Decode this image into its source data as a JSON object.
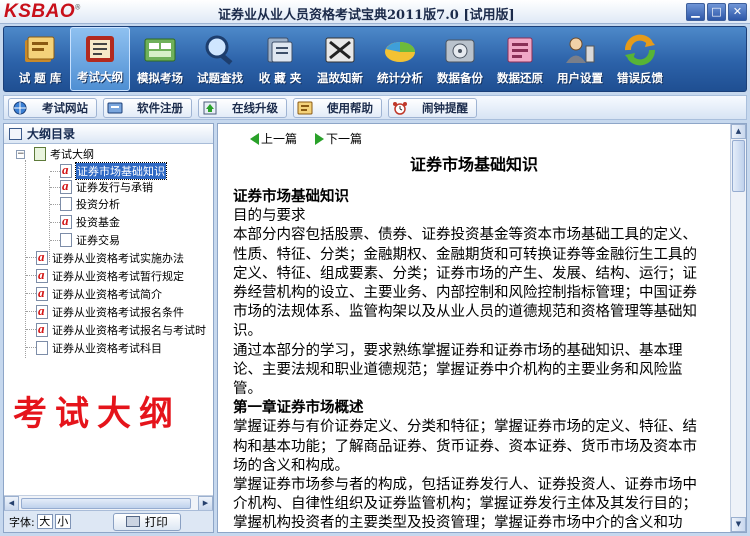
{
  "app": {
    "logo": "KSBAO",
    "logo_mark": "®",
    "title": "证券业从业人员资格考试宝典2011版7.0 [试用版]"
  },
  "toolbar": {
    "items": [
      {
        "label": "试 题 库",
        "icon": "question-bank-icon"
      },
      {
        "label": "考试大纲",
        "icon": "syllabus-icon"
      },
      {
        "label": "模拟考场",
        "icon": "mock-exam-icon"
      },
      {
        "label": "试题查找",
        "icon": "search-icon"
      },
      {
        "label": "收 藏 夹",
        "icon": "favorites-icon"
      },
      {
        "label": "温故知新",
        "icon": "review-icon"
      },
      {
        "label": "统计分析",
        "icon": "statistics-icon"
      },
      {
        "label": "数据备份",
        "icon": "backup-icon"
      },
      {
        "label": "数据还原",
        "icon": "restore-icon"
      },
      {
        "label": "用户设置",
        "icon": "user-settings-icon"
      },
      {
        "label": "错误反馈",
        "icon": "feedback-icon"
      }
    ],
    "active_index": 1
  },
  "toolbar2": {
    "items": [
      {
        "label": "考试网站",
        "icon": "globe-icon"
      },
      {
        "label": "软件注册",
        "icon": "register-icon"
      },
      {
        "label": "在线升级",
        "icon": "upgrade-icon"
      },
      {
        "label": "使用帮助",
        "icon": "help-icon"
      },
      {
        "label": "闹钟提醒",
        "icon": "alarm-icon"
      }
    ]
  },
  "tree": {
    "header": "大纲目录",
    "root": "考试大纲",
    "children": [
      "证券市场基础知识",
      "证券发行与承销",
      "投资分析",
      "投资基金",
      "证券交易"
    ],
    "selected": "证券市场基础知识",
    "docs": [
      "证券从业资格考试实施办法",
      "证券从业资格考试暂行规定",
      "证券从业资格考试简介",
      "证券从业资格考试报名条件",
      "证券从业资格考试报名与考试时",
      "证券从业资格考试科目"
    ]
  },
  "banner": "考试大纲",
  "footer": {
    "font_label": "字体:",
    "font_big": "大",
    "font_small": "小",
    "print": "打印"
  },
  "content": {
    "prev": "上一篇",
    "next": "下一篇",
    "title": "证券市场基础知识",
    "paragraphs": [
      {
        "text": "证券市场基础知识",
        "bold": true
      },
      {
        "text": "目的与要求",
        "bold": false
      },
      {
        "text": "本部分内容包括股票、债券、证券投资基金等资本市场基础工具的定义、性质、特征、分类；金融期权、金融期货和可转换证券等金融衍生工具的定义、特征、组成要素、分类；证券市场的产生、发展、结构、运行；证券经营机构的设立、主要业务、内部控制和风险控制指标管理；中国证券市场的法规体系、监管构架以及从业人员的道德规范和资格管理等基础知识。",
        "bold": false
      },
      {
        "text": "通过本部分的学习，要求熟练掌握证券和证券市场的基础知识、基本理论、主要法规和职业道德规范；掌握证券中介机构的主要业务和风险监管。",
        "bold": false
      },
      {
        "text": "第一章证券市场概述",
        "bold": true
      },
      {
        "text": "掌握证券与有价证券定义、分类和特征；掌握证券市场的定义、特征、结构和基本功能；了解商品证券、货币证券、资本证券、货币市场及资本市场的含义和构成。",
        "bold": false
      },
      {
        "text": "掌握证券市场参与者的构成，包括证券发行人、证券投资人、证券市场中介机构、自律性组织及证券监管机构；掌握证券发行主体及其发行目的；掌握机构投资者的主要类型及投资管理；掌握证券市场中介的含义和功能；证券市场自律性组织的构成、职能与",
        "bold": false
      }
    ]
  }
}
